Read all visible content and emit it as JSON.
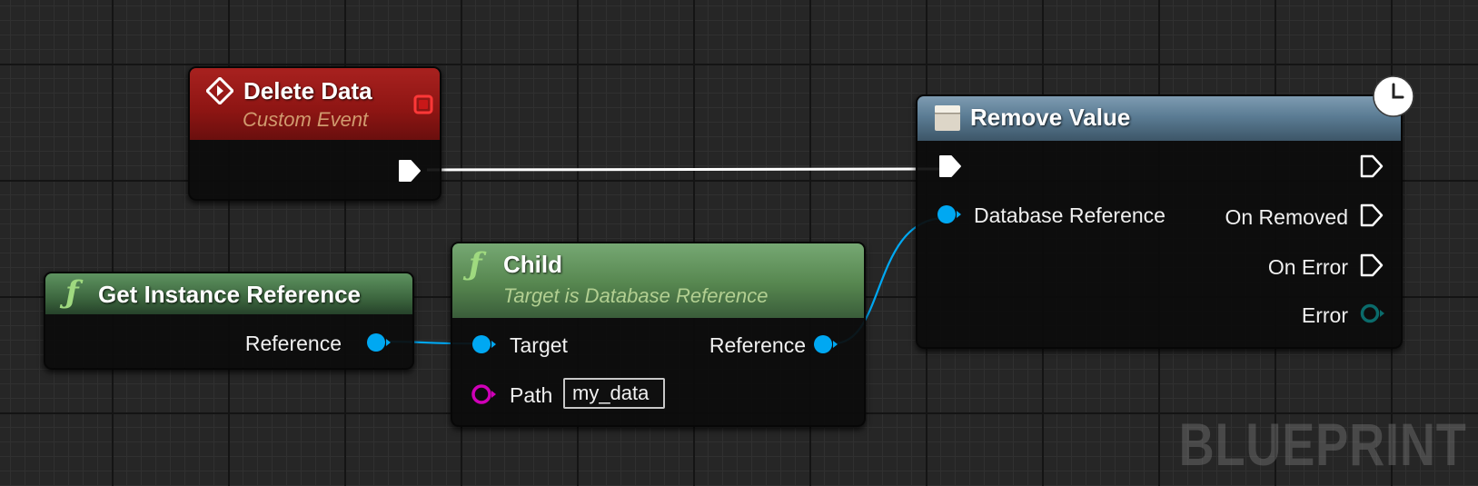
{
  "nodes": {
    "delete_data": {
      "title": "Delete Data",
      "subtitle": "Custom Event"
    },
    "get_instance": {
      "title": "Get Instance Reference",
      "output_label": "Reference"
    },
    "child": {
      "title": "Child",
      "subtitle": "Target is Database Reference",
      "input_target_label": "Target",
      "input_path_label": "Path",
      "path_value": "my_data",
      "output_label": "Reference"
    },
    "remove_value": {
      "title": "Remove Value",
      "input_db_label": "Database Reference",
      "on_removed_label": "On Removed",
      "on_error_label": "On Error",
      "error_label": "Error"
    }
  },
  "colors": {
    "event_header": "#a8211f",
    "function_header": "#5e9360",
    "latent_header": "#7e9bb1",
    "object_pin": "#00a8f2",
    "string_pin": "#d000b8",
    "error_pin": "#0a6b6b",
    "exec_pin": "#ffffff"
  },
  "watermark": "BLUEPRINT"
}
